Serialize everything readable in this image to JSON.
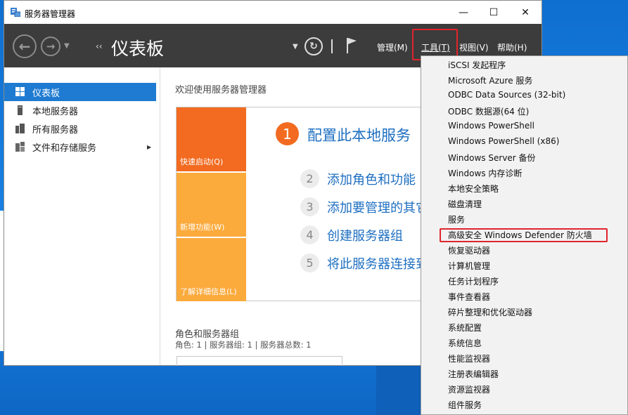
{
  "window": {
    "title": "服务器管理器",
    "minimize": "—",
    "maximize": "☐",
    "close": "✕"
  },
  "cmdbar": {
    "back": "←",
    "forward": "→",
    "page_title": "仪表板",
    "breadcrumb_arrow": "‹‹",
    "menus": {
      "manage": "管理(M)",
      "tools": "工具(T)",
      "view": "视图(V)",
      "help": "帮助(H)"
    }
  },
  "sidebar": {
    "items": [
      {
        "label": "仪表板"
      },
      {
        "label": "本地服务器"
      },
      {
        "label": "所有服务器"
      },
      {
        "label": "文件和存储服务"
      }
    ]
  },
  "main": {
    "welcome": "欢迎使用服务器管理器",
    "tiles": {
      "quick_start": "快速启动(Q)",
      "whats_new": "新增功能(W)",
      "learn_more": "了解详细信息(L)"
    },
    "steps": [
      {
        "num": "1",
        "text": "配置此本地服务"
      },
      {
        "num": "2",
        "text": "添加角色和功能"
      },
      {
        "num": "3",
        "text": "添加要管理的其它"
      },
      {
        "num": "4",
        "text": "创建服务器组"
      },
      {
        "num": "5",
        "text": "将此服务器连接到"
      }
    ],
    "roles_title": "角色和服务器组",
    "roles_subtitle": "角色: 1 | 服务器组: 1 | 服务器总数: 1"
  },
  "tools_menu": {
    "items": [
      "iSCSI 发起程序",
      "Microsoft Azure 服务",
      "ODBC Data Sources (32-bit)",
      "ODBC 数据源(64 位)",
      "Windows PowerShell",
      "Windows PowerShell (x86)",
      "Windows Server 备份",
      "Windows 内存诊断",
      "本地安全策略",
      "磁盘清理",
      "服务",
      "高级安全 Windows Defender 防火墙",
      "恢复驱动器",
      "计算机管理",
      "任务计划程序",
      "事件查看器",
      "碎片整理和优化驱动器",
      "系统配置",
      "系统信息",
      "性能监视器",
      "注册表编辑器",
      "资源监视器",
      "组件服务"
    ]
  },
  "colors": {
    "accent_red": "#e0242d",
    "tile_orange": "#f26b21",
    "tile_light_orange": "#fbaa3c",
    "link_blue": "#1e6fc1",
    "selection_blue": "#1f7bd1"
  }
}
